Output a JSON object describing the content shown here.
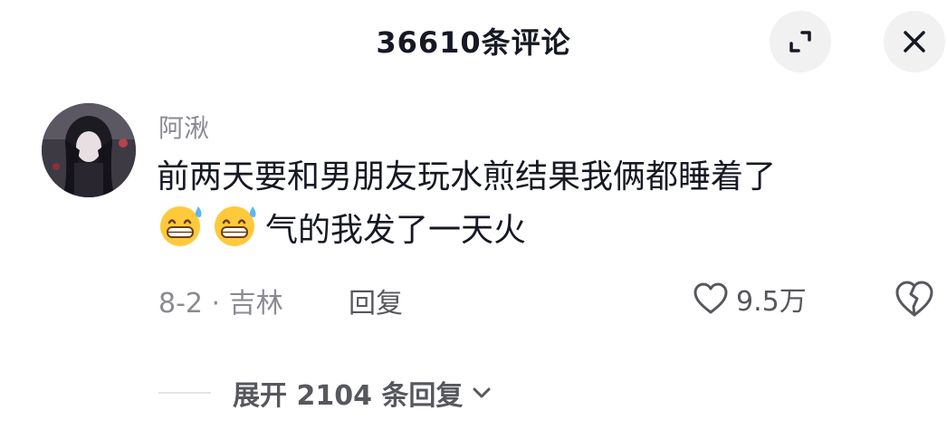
{
  "header": {
    "title": "36610条评论",
    "expand_icon": "expand-icon",
    "close_icon": "close-icon"
  },
  "comment": {
    "avatar_icon": "avatar",
    "username": "阿湫",
    "text_line1": "前两天要和男朋友玩水煎结果我俩都睡着了",
    "emojis": [
      "grinning-sweat-emoji",
      "grinning-sweat-emoji"
    ],
    "text_line2": "气的我发了一天火",
    "date_location": "8-2 · 吉林",
    "reply_label": "回复",
    "like_icon": "heart-outline-icon",
    "like_count": "9.5万",
    "dislike_icon": "broken-heart-icon"
  },
  "replies": {
    "expand_label": "展开 2104 条回复",
    "chevron_icon": "chevron-down-icon"
  },
  "colors": {
    "text_primary": "#161823",
    "text_secondary": "#8a8b91",
    "text_action": "#57585d",
    "button_bg": "#f1f1f2",
    "emoji_yellow": "#ffc93c"
  }
}
